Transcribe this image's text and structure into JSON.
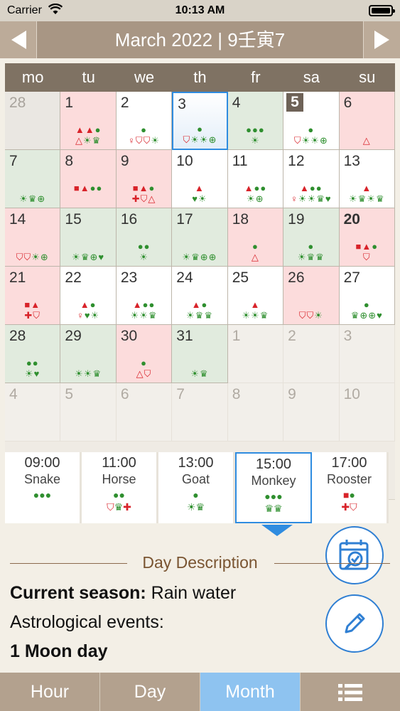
{
  "status": {
    "carrier": "Carrier",
    "time": "10:13 AM"
  },
  "header": {
    "title": "March 2022  |  9壬寅7"
  },
  "weekdays": [
    "mo",
    "tu",
    "we",
    "th",
    "fr",
    "sa",
    "su"
  ],
  "days": [
    {
      "n": "28",
      "c": "grey",
      "r1": "",
      "r2": ""
    },
    {
      "n": "1",
      "c": "red",
      "r1": "▲▲●",
      "r2": "△☀♛"
    },
    {
      "n": "2",
      "c": "",
      "r1": "●",
      "r2": "♀⛉⛉☀"
    },
    {
      "n": "3",
      "c": "selected",
      "r1": "●",
      "r2": "⛉☀☀⊕"
    },
    {
      "n": "4",
      "c": "green",
      "r1": "●●●",
      "r2": "☀"
    },
    {
      "n": "5",
      "c": "badge",
      "r1": "●",
      "r2": "⛉☀☀⊕"
    },
    {
      "n": "6",
      "c": "red",
      "r1": "",
      "r2": "△"
    },
    {
      "n": "7",
      "c": "green",
      "r1": "",
      "r2": "☀♛⊕"
    },
    {
      "n": "8",
      "c": "red",
      "r1": "■▲●●",
      "r2": ""
    },
    {
      "n": "9",
      "c": "red",
      "r1": "■▲●",
      "r2": "✚⛉△"
    },
    {
      "n": "10",
      "c": "",
      "r1": "▲",
      "r2": "♥☀"
    },
    {
      "n": "11",
      "c": "",
      "r1": "▲●●",
      "r2": "☀⊕"
    },
    {
      "n": "12",
      "c": "",
      "r1": "▲●●",
      "r2": "♀☀☀♛♥"
    },
    {
      "n": "13",
      "c": "",
      "r1": "▲",
      "r2": "☀♛☀♛"
    },
    {
      "n": "14",
      "c": "red",
      "r1": "",
      "r2": "⛉⛉☀⊕"
    },
    {
      "n": "15",
      "c": "green",
      "r1": "",
      "r2": "☀♛⊕♥"
    },
    {
      "n": "16",
      "c": "green",
      "r1": "●●",
      "r2": "☀"
    },
    {
      "n": "17",
      "c": "green",
      "r1": "",
      "r2": "☀♛⊕⊕"
    },
    {
      "n": "18",
      "c": "red",
      "r1": "●",
      "r2": "△"
    },
    {
      "n": "19",
      "c": "green",
      "r1": "●",
      "r2": "☀♛♛"
    },
    {
      "n": "20",
      "c": "red bold",
      "r1": "■▲●",
      "r2": "⛉"
    },
    {
      "n": "21",
      "c": "red",
      "r1": "■▲",
      "r2": "✚⛉"
    },
    {
      "n": "22",
      "c": "",
      "r1": "▲●",
      "r2": "♀♥☀"
    },
    {
      "n": "23",
      "c": "",
      "r1": "▲●●",
      "r2": "☀☀♛"
    },
    {
      "n": "24",
      "c": "",
      "r1": "▲●",
      "r2": "☀♛♛"
    },
    {
      "n": "25",
      "c": "",
      "r1": "▲",
      "r2": "☀☀♛"
    },
    {
      "n": "26",
      "c": "red",
      "r1": "",
      "r2": "⛉⛉☀"
    },
    {
      "n": "27",
      "c": "",
      "r1": "●",
      "r2": "♛⊕⊕♥"
    },
    {
      "n": "28",
      "c": "green",
      "r1": "●●",
      "r2": "☀♥"
    },
    {
      "n": "29",
      "c": "green",
      "r1": "",
      "r2": "☀☀♛"
    },
    {
      "n": "30",
      "c": "red",
      "r1": "●",
      "r2": "△⛉"
    },
    {
      "n": "31",
      "c": "green",
      "r1": "",
      "r2": "☀♛"
    },
    {
      "n": "1",
      "c": "other",
      "r1": "",
      "r2": ""
    },
    {
      "n": "2",
      "c": "other",
      "r1": "",
      "r2": ""
    },
    {
      "n": "3",
      "c": "other",
      "r1": "",
      "r2": ""
    },
    {
      "n": "4",
      "c": "other",
      "r1": "",
      "r2": ""
    },
    {
      "n": "5",
      "c": "other",
      "r1": "",
      "r2": ""
    },
    {
      "n": "6",
      "c": "other",
      "r1": "",
      "r2": ""
    },
    {
      "n": "7",
      "c": "other",
      "r1": "",
      "r2": ""
    },
    {
      "n": "8",
      "c": "other",
      "r1": "",
      "r2": ""
    },
    {
      "n": "9",
      "c": "other",
      "r1": "",
      "r2": ""
    },
    {
      "n": "10",
      "c": "other",
      "r1": "",
      "r2": ""
    }
  ],
  "hours": [
    {
      "time": "09:00",
      "name": "Snake",
      "s1": "●●●",
      "s2": ""
    },
    {
      "time": "11:00",
      "name": "Horse",
      "s1": "●●",
      "s2": "⛉♛✚"
    },
    {
      "time": "13:00",
      "name": "Goat",
      "s1": "●",
      "s2": "☀♛"
    },
    {
      "time": "15:00",
      "name": "Monkey",
      "s1": "●●●",
      "s2": "♛♛"
    },
    {
      "time": "17:00",
      "name": "Rooster",
      "s1": "■●",
      "s2": "✚⛉"
    }
  ],
  "description": {
    "title": "Day Description",
    "season_label": "Current season:",
    "season_value": "Rain water",
    "events_label": "Astrological events:",
    "moon_day": "1 Moon day"
  },
  "tabs": [
    "Hour",
    "Day",
    "Month"
  ],
  "colors": {
    "accent": "#2f8ce0",
    "header": "#a89684",
    "red_cell": "#fcdcdc",
    "green_cell": "#e1ebde"
  }
}
